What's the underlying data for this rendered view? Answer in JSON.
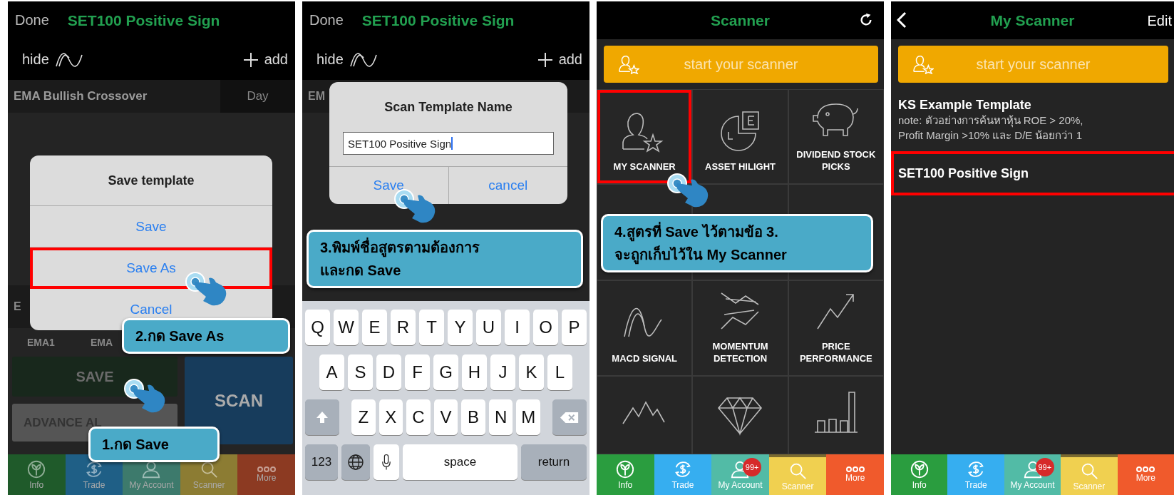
{
  "panels": [
    {
      "kind": "template_editor",
      "dimmed": true,
      "header": {
        "left": "Done",
        "title": "SET100 Positive Sign"
      },
      "toolbar": {
        "hide": "hide",
        "add": "add"
      },
      "condition": {
        "name": "EMA Bullish Crossover",
        "period": "Day"
      },
      "hidden_row_label": "E",
      "params": [
        "EMA1",
        "EMA"
      ],
      "save_button": "SAVE",
      "alert_button": "ADVANCE AL",
      "scan_button": "SCAN",
      "dialog": {
        "title": "Save template",
        "options": [
          {
            "label": "Save",
            "highlighted": false
          },
          {
            "label": "Save As",
            "highlighted": true
          },
          {
            "label": "Cancel",
            "highlighted": false
          }
        ]
      },
      "callouts": [
        {
          "lines": [
            "2.กด Save As"
          ]
        },
        {
          "lines": [
            "1.กด Save"
          ]
        }
      ],
      "tabs": [
        {
          "label": "Info",
          "color": "#1f5a2a"
        },
        {
          "label": "Trade",
          "color": "#1f5f86"
        },
        {
          "label": "My Account",
          "color": "#3d7a6c"
        },
        {
          "label": "Scanner",
          "color": "#8c7c33"
        },
        {
          "label": "More",
          "color": "#8c3a22"
        }
      ]
    },
    {
      "kind": "name_dialog",
      "header": {
        "left": "Done",
        "title": "SET100 Positive Sign"
      },
      "toolbar": {
        "hide": "hide",
        "add": "add"
      },
      "hidden_row_label": "EM",
      "dialog": {
        "title": "Scan Template Name",
        "value": "SET100 Positive Sign",
        "buttons": [
          "Save",
          "cancel"
        ]
      },
      "callouts": [
        {
          "lines": [
            "3.พิมพ์ชื่อสูตรตามต้องการ",
            "และกด Save"
          ]
        }
      ],
      "keyboard": {
        "rows": [
          [
            "Q",
            "W",
            "E",
            "R",
            "T",
            "Y",
            "U",
            "I",
            "O",
            "P"
          ],
          [
            "A",
            "S",
            "D",
            "F",
            "G",
            "H",
            "J",
            "K",
            "L"
          ],
          [
            "Z",
            "X",
            "C",
            "V",
            "B",
            "N",
            "M"
          ]
        ],
        "number_key": "123",
        "space_key": "space",
        "return_key": "return"
      }
    },
    {
      "kind": "scanner_menu",
      "header": {
        "title": "Scanner"
      },
      "start_button": "start your scanner",
      "tiles": [
        {
          "label": "MY SCANNER",
          "highlighted": true
        },
        {
          "label": "ASSET HILIGHT",
          "highlighted": false
        },
        {
          "label": "DIVIDEND STOCK PICKS",
          "highlighted": false
        },
        {
          "highlighted": false
        },
        {
          "highlighted": false
        },
        {
          "highlighted": false
        },
        {
          "label": "MACD SIGNAL",
          "highlighted": false
        },
        {
          "label": "MOMENTUM DETECTION",
          "highlighted": false
        },
        {
          "label": "PRICE PERFORMANCE",
          "highlighted": false
        },
        {
          "highlighted": false
        },
        {
          "highlighted": false
        },
        {
          "highlighted": false
        }
      ],
      "callouts": [
        {
          "lines": [
            "4.สูตรที่ Save ไว้ตามข้อ 3.",
            "จะถูกเก็บไว้ใน My Scanner"
          ]
        }
      ],
      "badge": "99+",
      "tabs": [
        {
          "label": "Info",
          "color": "#2a9d3f",
          "selected": false
        },
        {
          "label": "Trade",
          "color": "#36aef0",
          "selected": false
        },
        {
          "label": "My Account",
          "color": "#52bba6",
          "selected": false
        },
        {
          "label": "Scanner",
          "color": "#f0d050",
          "selected": true
        },
        {
          "label": "More",
          "color": "#f05a2c",
          "selected": false
        }
      ]
    },
    {
      "kind": "my_scanner",
      "header": {
        "title": "My Scanner",
        "right": "Edit"
      },
      "start_button": "start your scanner",
      "templates": [
        {
          "name": "KS Example Template",
          "note_lines": [
            "note: ตัวอย่างการค้นหาหุ้น ROE > 20%,",
            "Profit Margin >10% และ D/E น้อยกว่า 1"
          ],
          "highlighted": false
        },
        {
          "name": "SET100 Positive Sign",
          "highlighted": true
        }
      ],
      "badge": "99+",
      "tabs": [
        {
          "label": "Info",
          "color": "#2a9d3f",
          "selected": false
        },
        {
          "label": "Trade",
          "color": "#36aef0",
          "selected": false
        },
        {
          "label": "My Account",
          "color": "#52bba6",
          "selected": false
        },
        {
          "label": "Scanner",
          "color": "#f0d050",
          "selected": true
        },
        {
          "label": "More",
          "color": "#f05a2c",
          "selected": false
        }
      ]
    }
  ]
}
